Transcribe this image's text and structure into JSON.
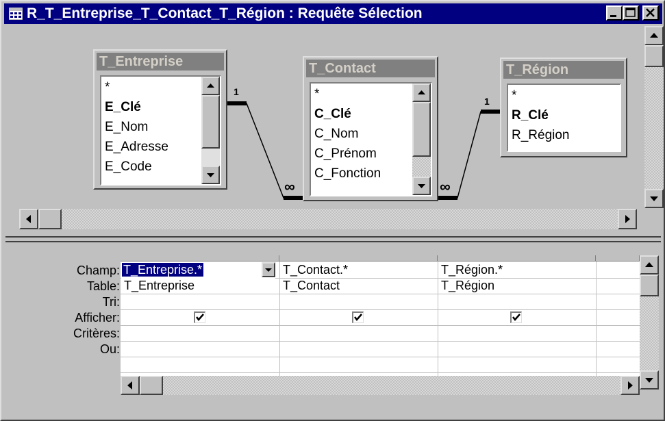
{
  "window": {
    "title": "R_T_Entreprise_T_Contact_T_Région : Requête Sélection",
    "minimize_label": "_",
    "maximize_label": "□",
    "close_label": "×"
  },
  "tables": [
    {
      "name": "T_Entreprise",
      "fields": [
        "*",
        "E_Clé",
        "E_Nom",
        "E_Adresse",
        "E_Code"
      ],
      "key_field": "E_Clé"
    },
    {
      "name": "T_Contact",
      "fields": [
        "*",
        "C_Clé",
        "C_Nom",
        "C_Prénom",
        "C_Fonction"
      ],
      "key_field": "C_Clé"
    },
    {
      "name": "T_Région",
      "fields": [
        "*",
        "R_Clé",
        "R_Région"
      ],
      "key_field": "R_Clé"
    }
  ],
  "relations": [
    {
      "from": "T_Entreprise",
      "to": "T_Contact",
      "one_label": "1",
      "many_label": "∞"
    },
    {
      "from": "T_Région",
      "to": "T_Contact",
      "one_label": "1",
      "many_label": "∞"
    }
  ],
  "grid": {
    "row_labels": [
      "Champ:",
      "Table:",
      "Tri:",
      "Afficher:",
      "Critères:",
      "Ou:"
    ],
    "columns": [
      {
        "champ": "T_Entreprise.*",
        "table": "T_Entreprise",
        "tri": "",
        "afficher": true,
        "criteres": "",
        "ou": ""
      },
      {
        "champ": "T_Contact.*",
        "table": "T_Contact",
        "tri": "",
        "afficher": true,
        "criteres": "",
        "ou": ""
      },
      {
        "champ": "T_Région.*",
        "table": "T_Région",
        "tri": "",
        "afficher": true,
        "criteres": "",
        "ou": ""
      },
      {
        "champ": "",
        "table": "",
        "tri": "",
        "afficher": false,
        "criteres": "",
        "ou": ""
      }
    ]
  },
  "colors": {
    "title_bar": "#000080",
    "inactive_caption": "#808080",
    "face": "#c0c0c0",
    "selection": "#000080"
  }
}
